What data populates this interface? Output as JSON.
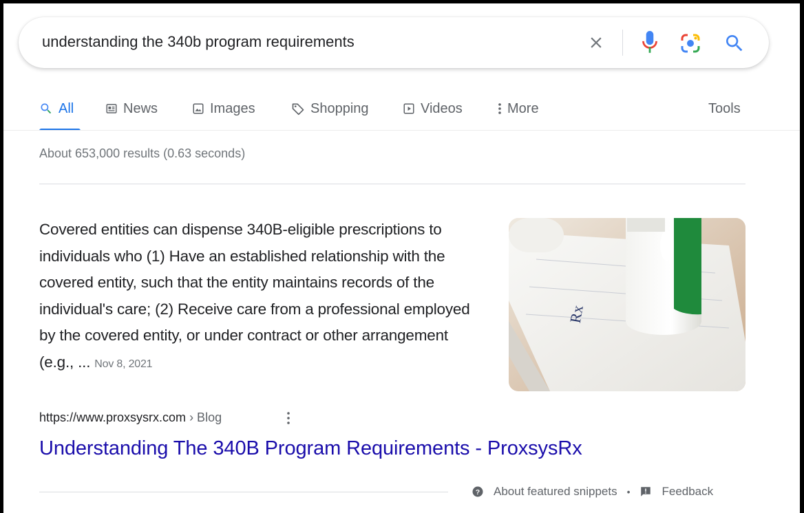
{
  "search": {
    "query": "understanding the 340b program requirements"
  },
  "tabs": [
    {
      "label": "All",
      "icon": "search-icon",
      "active": true
    },
    {
      "label": "News",
      "icon": "news-icon"
    },
    {
      "label": "Images",
      "icon": "image-icon"
    },
    {
      "label": "Shopping",
      "icon": "tag-icon"
    },
    {
      "label": "Videos",
      "icon": "play-icon"
    },
    {
      "label": "More",
      "icon": "more-vertical-icon"
    }
  ],
  "tools_label": "Tools",
  "result_stats": "About 653,000 results (0.63 seconds)",
  "featured_snippet": {
    "text": "Covered entities can dispense 340B-eligible prescriptions to individuals who (1) Have an established relationship with the covered entity, such that the entity maintains records of the individual's care; (2) Receive care from a professional employed by the covered entity, or under contract or other arrangement (e.g., ...",
    "date": "Nov 8, 2021",
    "image_text": "Rx",
    "source_domain": "https://www.proxsysrx.com",
    "source_breadcrumb": "› Blog",
    "title": "Understanding The 340B Program Requirements - ProxsysRx"
  },
  "footer": {
    "about_label": "About featured snippets",
    "separator": "•",
    "feedback_label": "Feedback"
  },
  "colors": {
    "accent": "#1a73e8",
    "link": "#1a0dab",
    "text": "#202124",
    "muted": "#70757a"
  }
}
